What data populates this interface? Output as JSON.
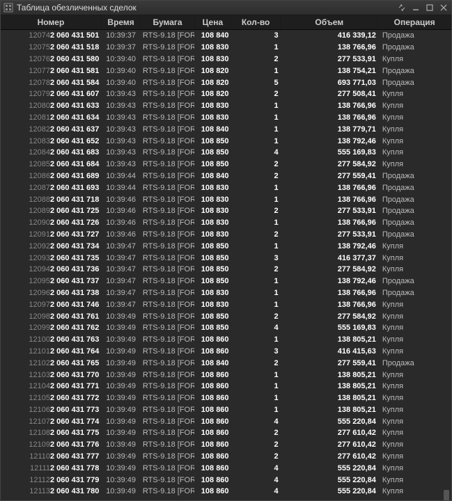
{
  "window": {
    "title": "Таблица обезличенных сделок"
  },
  "columns": [
    "Номер",
    "Время",
    "Бумага",
    "Цена",
    "Кол-во",
    "Объем",
    "Операция"
  ],
  "rows": [
    {
      "n_pre": "12074",
      "n_suf": "2 060 431 501",
      "t": "10:39:37",
      "s": "RTS-9.18 [FOR",
      "p": "108 840",
      "q": "3",
      "v": "416 339,12",
      "op": "Продажа"
    },
    {
      "n_pre": "12075",
      "n_suf": "2 060 431 518",
      "t": "10:39:37",
      "s": "RTS-9.18 [FOR",
      "p": "108 830",
      "q": "1",
      "v": "138 766,96",
      "op": "Продажа"
    },
    {
      "n_pre": "12076",
      "n_suf": "2 060 431 580",
      "t": "10:39:40",
      "s": "RTS-9.18 [FOR",
      "p": "108 830",
      "q": "2",
      "v": "277 533,91",
      "op": "Купля"
    },
    {
      "n_pre": "12077",
      "n_suf": "2 060 431 581",
      "t": "10:39:40",
      "s": "RTS-9.18 [FOR",
      "p": "108 820",
      "q": "1",
      "v": "138 754,21",
      "op": "Продажа"
    },
    {
      "n_pre": "12078",
      "n_suf": "2 060 431 584",
      "t": "10:39:40",
      "s": "RTS-9.18 [FOR",
      "p": "108 820",
      "q": "5",
      "v": "693 771,03",
      "op": "Продажа"
    },
    {
      "n_pre": "12079",
      "n_suf": "2 060 431 607",
      "t": "10:39:43",
      "s": "RTS-9.18 [FOR",
      "p": "108 820",
      "q": "2",
      "v": "277 508,41",
      "op": "Купля"
    },
    {
      "n_pre": "12080",
      "n_suf": "2 060 431 633",
      "t": "10:39:43",
      "s": "RTS-9.18 [FOR",
      "p": "108 830",
      "q": "1",
      "v": "138 766,96",
      "op": "Купля"
    },
    {
      "n_pre": "12081",
      "n_suf": "2 060 431 634",
      "t": "10:39:43",
      "s": "RTS-9.18 [FOR",
      "p": "108 830",
      "q": "1",
      "v": "138 766,96",
      "op": "Купля"
    },
    {
      "n_pre": "12082",
      "n_suf": "2 060 431 637",
      "t": "10:39:43",
      "s": "RTS-9.18 [FOR",
      "p": "108 840",
      "q": "1",
      "v": "138 779,71",
      "op": "Купля"
    },
    {
      "n_pre": "12083",
      "n_suf": "2 060 431 652",
      "t": "10:39:43",
      "s": "RTS-9.18 [FOR",
      "p": "108 850",
      "q": "1",
      "v": "138 792,46",
      "op": "Купля"
    },
    {
      "n_pre": "12084",
      "n_suf": "2 060 431 683",
      "t": "10:39:43",
      "s": "RTS-9.18 [FOR",
      "p": "108 850",
      "q": "4",
      "v": "555 169,83",
      "op": "Купля"
    },
    {
      "n_pre": "12085",
      "n_suf": "2 060 431 684",
      "t": "10:39:43",
      "s": "RTS-9.18 [FOR",
      "p": "108 850",
      "q": "2",
      "v": "277 584,92",
      "op": "Купля"
    },
    {
      "n_pre": "12086",
      "n_suf": "2 060 431 689",
      "t": "10:39:44",
      "s": "RTS-9.18 [FOR",
      "p": "108 840",
      "q": "2",
      "v": "277 559,41",
      "op": "Продажа"
    },
    {
      "n_pre": "12087",
      "n_suf": "2 060 431 693",
      "t": "10:39:44",
      "s": "RTS-9.18 [FOR",
      "p": "108 830",
      "q": "1",
      "v": "138 766,96",
      "op": "Продажа"
    },
    {
      "n_pre": "12088",
      "n_suf": "2 060 431 718",
      "t": "10:39:46",
      "s": "RTS-9.18 [FOR",
      "p": "108 830",
      "q": "1",
      "v": "138 766,96",
      "op": "Продажа"
    },
    {
      "n_pre": "12089",
      "n_suf": "2 060 431 725",
      "t": "10:39:46",
      "s": "RTS-9.18 [FOR",
      "p": "108 830",
      "q": "2",
      "v": "277 533,91",
      "op": "Продажа"
    },
    {
      "n_pre": "12090",
      "n_suf": "2 060 431 726",
      "t": "10:39:46",
      "s": "RTS-9.18 [FOR",
      "p": "108 830",
      "q": "1",
      "v": "138 766,96",
      "op": "Продажа"
    },
    {
      "n_pre": "12091",
      "n_suf": "2 060 431 727",
      "t": "10:39:46",
      "s": "RTS-9.18 [FOR",
      "p": "108 830",
      "q": "2",
      "v": "277 533,91",
      "op": "Продажа"
    },
    {
      "n_pre": "12092",
      "n_suf": "2 060 431 734",
      "t": "10:39:47",
      "s": "RTS-9.18 [FOR",
      "p": "108 850",
      "q": "1",
      "v": "138 792,46",
      "op": "Купля"
    },
    {
      "n_pre": "12093",
      "n_suf": "2 060 431 735",
      "t": "10:39:47",
      "s": "RTS-9.18 [FOR",
      "p": "108 850",
      "q": "3",
      "v": "416 377,37",
      "op": "Купля"
    },
    {
      "n_pre": "12094",
      "n_suf": "2 060 431 736",
      "t": "10:39:47",
      "s": "RTS-9.18 [FOR",
      "p": "108 850",
      "q": "2",
      "v": "277 584,92",
      "op": "Купля"
    },
    {
      "n_pre": "12095",
      "n_suf": "2 060 431 737",
      "t": "10:39:47",
      "s": "RTS-9.18 [FOR",
      "p": "108 850",
      "q": "1",
      "v": "138 792,46",
      "op": "Продажа"
    },
    {
      "n_pre": "12096",
      "n_suf": "2 060 431 738",
      "t": "10:39:47",
      "s": "RTS-9.18 [FOR",
      "p": "108 830",
      "q": "1",
      "v": "138 766,96",
      "op": "Продажа"
    },
    {
      "n_pre": "12097",
      "n_suf": "2 060 431 746",
      "t": "10:39:47",
      "s": "RTS-9.18 [FOR",
      "p": "108 830",
      "q": "1",
      "v": "138 766,96",
      "op": "Купля"
    },
    {
      "n_pre": "12098",
      "n_suf": "2 060 431 761",
      "t": "10:39:49",
      "s": "RTS-9.18 [FOR",
      "p": "108 850",
      "q": "2",
      "v": "277 584,92",
      "op": "Купля"
    },
    {
      "n_pre": "12099",
      "n_suf": "2 060 431 762",
      "t": "10:39:49",
      "s": "RTS-9.18 [FOR",
      "p": "108 850",
      "q": "4",
      "v": "555 169,83",
      "op": "Купля"
    },
    {
      "n_pre": "12100",
      "n_suf": "2 060 431 763",
      "t": "10:39:49",
      "s": "RTS-9.18 [FOR",
      "p": "108 860",
      "q": "1",
      "v": "138 805,21",
      "op": "Купля"
    },
    {
      "n_pre": "12101",
      "n_suf": "2 060 431 764",
      "t": "10:39:49",
      "s": "RTS-9.18 [FOR",
      "p": "108 860",
      "q": "3",
      "v": "416 415,63",
      "op": "Купля"
    },
    {
      "n_pre": "12102",
      "n_suf": "2 060 431 765",
      "t": "10:39:49",
      "s": "RTS-9.18 [FOR",
      "p": "108 840",
      "q": "2",
      "v": "277 559,41",
      "op": "Продажа"
    },
    {
      "n_pre": "12103",
      "n_suf": "2 060 431 770",
      "t": "10:39:49",
      "s": "RTS-9.18 [FOR",
      "p": "108 860",
      "q": "1",
      "v": "138 805,21",
      "op": "Купля"
    },
    {
      "n_pre": "12104",
      "n_suf": "2 060 431 771",
      "t": "10:39:49",
      "s": "RTS-9.18 [FOR",
      "p": "108 860",
      "q": "1",
      "v": "138 805,21",
      "op": "Купля"
    },
    {
      "n_pre": "12105",
      "n_suf": "2 060 431 772",
      "t": "10:39:49",
      "s": "RTS-9.18 [FOR",
      "p": "108 860",
      "q": "1",
      "v": "138 805,21",
      "op": "Купля"
    },
    {
      "n_pre": "12106",
      "n_suf": "2 060 431 773",
      "t": "10:39:49",
      "s": "RTS-9.18 [FOR",
      "p": "108 860",
      "q": "1",
      "v": "138 805,21",
      "op": "Купля"
    },
    {
      "n_pre": "12107",
      "n_suf": "2 060 431 774",
      "t": "10:39:49",
      "s": "RTS-9.18 [FOR",
      "p": "108 860",
      "q": "4",
      "v": "555 220,84",
      "op": "Купля"
    },
    {
      "n_pre": "12108",
      "n_suf": "2 060 431 775",
      "t": "10:39:49",
      "s": "RTS-9.18 [FOR",
      "p": "108 860",
      "q": "2",
      "v": "277 610,42",
      "op": "Купля"
    },
    {
      "n_pre": "12109",
      "n_suf": "2 060 431 776",
      "t": "10:39:49",
      "s": "RTS-9.18 [FOR",
      "p": "108 860",
      "q": "2",
      "v": "277 610,42",
      "op": "Купля"
    },
    {
      "n_pre": "12110",
      "n_suf": "2 060 431 777",
      "t": "10:39:49",
      "s": "RTS-9.18 [FOR",
      "p": "108 860",
      "q": "2",
      "v": "277 610,42",
      "op": "Купля"
    },
    {
      "n_pre": "12111",
      "n_suf": "2 060 431 778",
      "t": "10:39:49",
      "s": "RTS-9.18 [FOR",
      "p": "108 860",
      "q": "4",
      "v": "555 220,84",
      "op": "Купля"
    },
    {
      "n_pre": "12112",
      "n_suf": "2 060 431 779",
      "t": "10:39:49",
      "s": "RTS-9.18 [FOR",
      "p": "108 860",
      "q": "4",
      "v": "555 220,84",
      "op": "Купля"
    },
    {
      "n_pre": "12113",
      "n_suf": "2 060 431 780",
      "t": "10:39:49",
      "s": "RTS-9.18 [FOR",
      "p": "108 860",
      "q": "4",
      "v": "555 220,84",
      "op": "Купля"
    }
  ]
}
